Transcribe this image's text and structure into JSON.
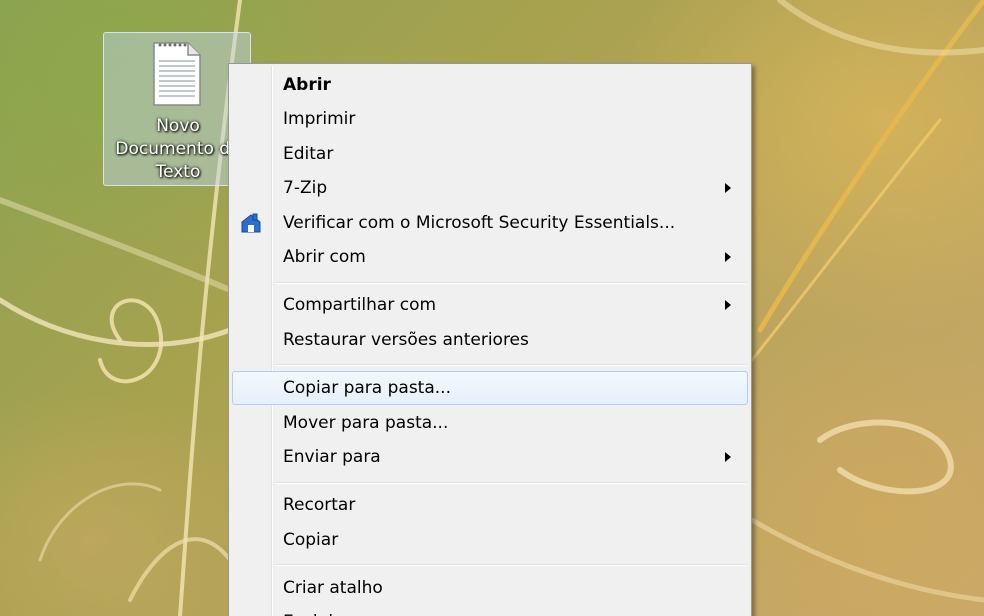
{
  "desktop": {
    "icon": {
      "label": "Novo\nDocumento de\nTexto",
      "icon": "text-document-icon"
    }
  },
  "context_menu": {
    "groups": [
      {
        "items": [
          {
            "label": "Abrir",
            "default": true
          },
          {
            "label": "Imprimir"
          },
          {
            "label": "Editar"
          },
          {
            "label": "7-Zip",
            "submenu": true
          },
          {
            "label": "Verificar com o Microsoft Security Essentials...",
            "icon": "microsoft-security-essentials-icon"
          },
          {
            "label": "Abrir com",
            "submenu": true
          }
        ]
      },
      {
        "items": [
          {
            "label": "Compartilhar com",
            "submenu": true
          },
          {
            "label": "Restaurar versões anteriores"
          }
        ]
      },
      {
        "items": [
          {
            "label": "Copiar para pasta...",
            "highlighted": true
          },
          {
            "label": "Mover para pasta..."
          },
          {
            "label": "Enviar para",
            "submenu": true
          }
        ]
      },
      {
        "items": [
          {
            "label": "Recortar"
          },
          {
            "label": "Copiar"
          }
        ]
      },
      {
        "items": [
          {
            "label": "Criar atalho"
          },
          {
            "label": "Excluir"
          }
        ]
      }
    ]
  },
  "colors": {
    "menu_background": "#f0f0f0",
    "highlight_border": "#aecff7",
    "selection_background": "#bed7f0"
  }
}
